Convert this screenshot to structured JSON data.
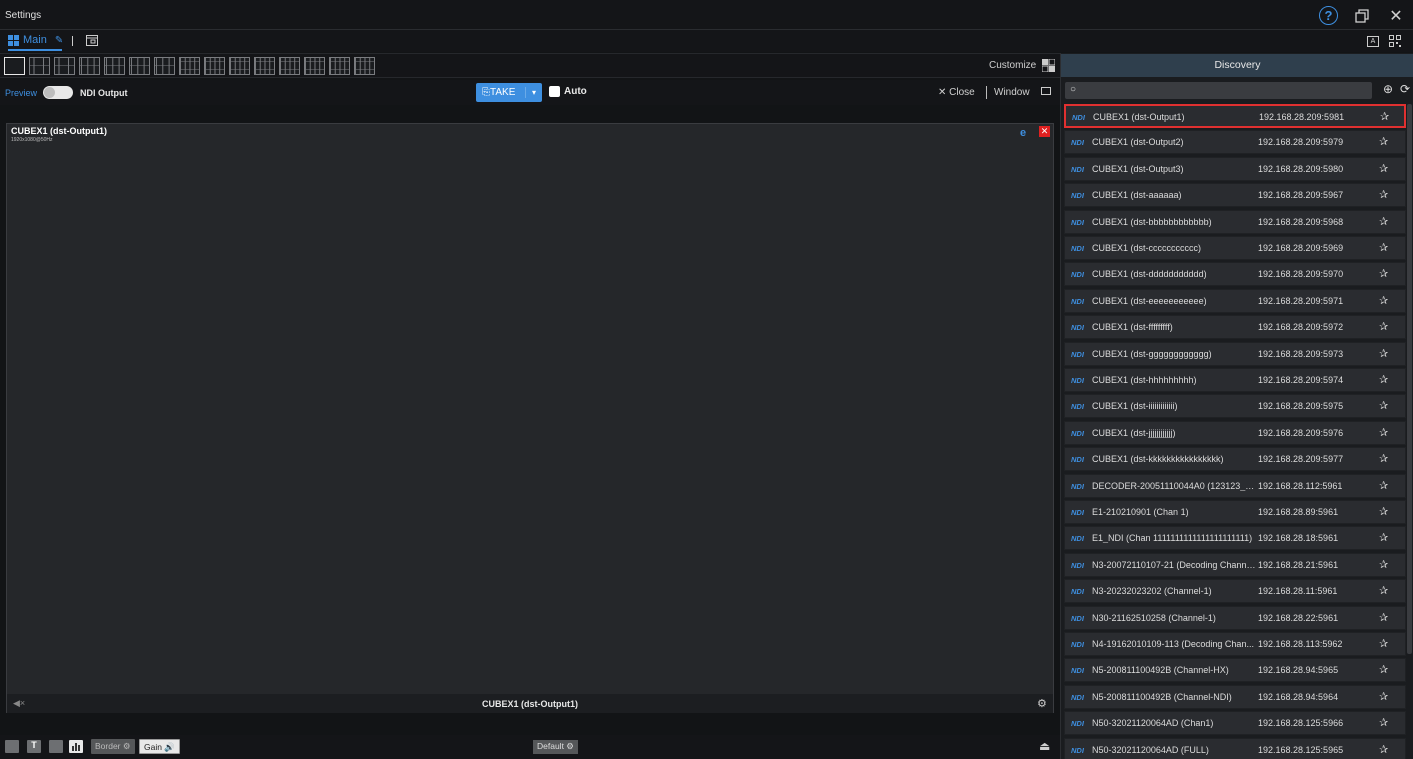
{
  "window": {
    "title": "Settings"
  },
  "tabs": {
    "main_label": "Main"
  },
  "layout": {
    "customize_label": "Customize",
    "presets_count": 15
  },
  "toolbar": {
    "preview_label": "Preview",
    "ndi_output_label": "NDI Output",
    "take_label": "TAKE",
    "auto_label": "Auto",
    "close_label": "Close",
    "window_label": "Window"
  },
  "panel": {
    "title": "CUBEX1 (dst-Output1)",
    "resolution": "1920x1080@50Hz",
    "footer_name": "CUBEX1 (dst-Output1)"
  },
  "bottom": {
    "border_label": "Border",
    "gain_label": "Gain",
    "default_label": "Default"
  },
  "discovery": {
    "header": "Discovery",
    "ndi_tag": "NDI",
    "items": [
      {
        "name": "CUBEX1 (dst-Output1)",
        "address": "192.168.28.209:5981",
        "selected": true
      },
      {
        "name": "CUBEX1 (dst-Output2)",
        "address": "192.168.28.209:5979"
      },
      {
        "name": "CUBEX1 (dst-Output3)",
        "address": "192.168.28.209:5980"
      },
      {
        "name": "CUBEX1 (dst-aaaaaa)",
        "address": "192.168.28.209:5967"
      },
      {
        "name": "CUBEX1 (dst-bbbbbbbbbbbb)",
        "address": "192.168.28.209:5968"
      },
      {
        "name": "CUBEX1 (dst-ccccccccccc)",
        "address": "192.168.28.209:5969"
      },
      {
        "name": "CUBEX1 (dst-ddddddddddd)",
        "address": "192.168.28.209:5970"
      },
      {
        "name": "CUBEX1 (dst-eeeeeeeeeee)",
        "address": "192.168.28.209:5971"
      },
      {
        "name": "CUBEX1 (dst-fffffffff)",
        "address": "192.168.28.209:5972"
      },
      {
        "name": "CUBEX1 (dst-gggggggggggg)",
        "address": "192.168.28.209:5973"
      },
      {
        "name": "CUBEX1 (dst-hhhhhhhhh)",
        "address": "192.168.28.209:5974"
      },
      {
        "name": "CUBEX1 (dst-iiiiiiiiiiiii)",
        "address": "192.168.28.209:5975"
      },
      {
        "name": "CUBEX1 (dst-jjjjjjjjjjjj)",
        "address": "192.168.28.209:5976"
      },
      {
        "name": "CUBEX1 (dst-kkkkkkkkkkkkkkkk)",
        "address": "192.168.28.209:5977"
      },
      {
        "name": "DECODER-20051110044A0 (123123_c...",
        "address": "192.168.28.112:5961"
      },
      {
        "name": "E1-210210901 (Chan 1)",
        "address": "192.168.28.89:5961"
      },
      {
        "name": "E1_NDI (Chan 1111111111111111111111)",
        "address": "192.168.28.18:5961"
      },
      {
        "name": "N3-20072110107-21 (Decoding Channel)",
        "address": "192.168.28.21:5961"
      },
      {
        "name": "N3-20232023202 (Channel-1)",
        "address": "192.168.28.11:5961"
      },
      {
        "name": "N30-21162510258 (Channel-1)",
        "address": "192.168.28.22:5961"
      },
      {
        "name": "N4-19162010109-113 (Decoding Chan...",
        "address": "192.168.28.113:5962"
      },
      {
        "name": "N5-200811100492B (Channel-HX)",
        "address": "192.168.28.94:5965"
      },
      {
        "name": "N5-200811100492B (Channel-NDI)",
        "address": "192.168.28.94:5964"
      },
      {
        "name": "N50-32021120064AD (Chan1)",
        "address": "192.168.28.125:5966"
      },
      {
        "name": "N50-32021120064AD (FULL)",
        "address": "192.168.28.125:5965"
      }
    ]
  },
  "colors": {
    "accent": "#3e8fe0",
    "selected_border": "#e03030",
    "background": "#121416"
  }
}
